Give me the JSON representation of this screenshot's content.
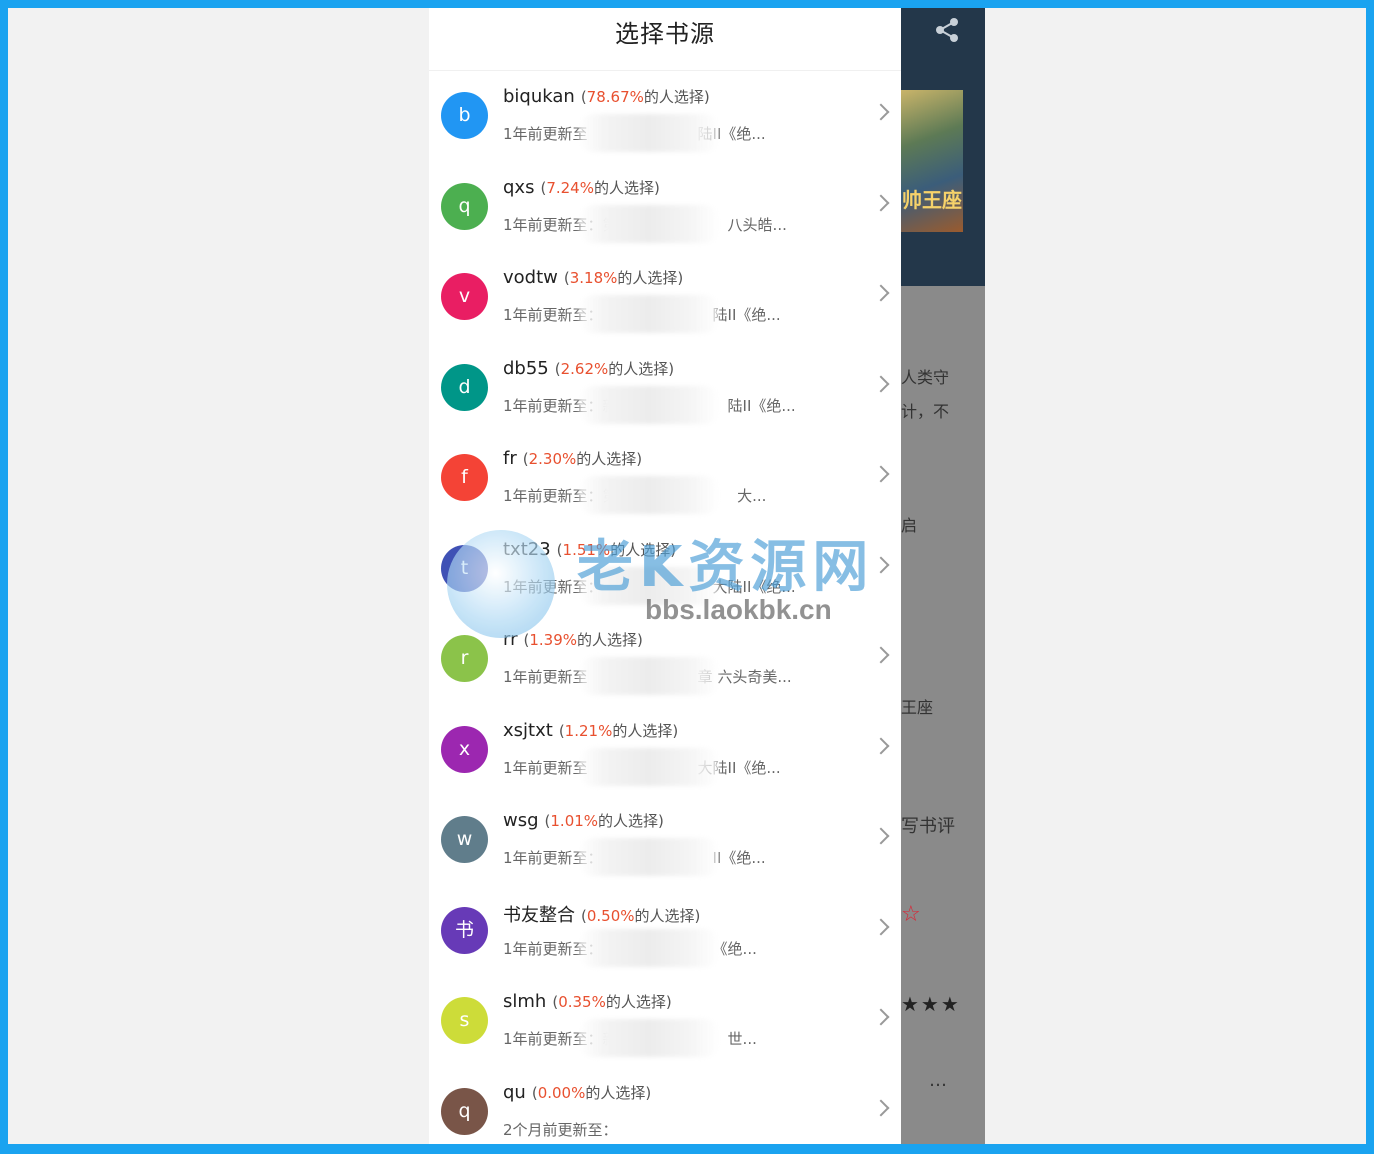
{
  "dialog": {
    "title": "选择书源",
    "sources": [
      {
        "initial": "b",
        "name": "biqukan",
        "percent": "78.67%",
        "suffix": "的人选择)",
        "update": "1年前更新至",
        "tail": "陆II《绝...",
        "color": "#2196f3"
      },
      {
        "initial": "q",
        "name": "qxs",
        "percent": "7.24%",
        "suffix": "的人选择)",
        "update": "1年前更新至：第",
        "tail": "八头皓...",
        "color": "#4caf50"
      },
      {
        "initial": "v",
        "name": "vodtw",
        "percent": "3.18%",
        "suffix": "的人选择)",
        "update": "1年前更新至：",
        "tail": "陆II《绝...",
        "color": "#e91e63"
      },
      {
        "initial": "d",
        "name": "db55",
        "percent": "2.62%",
        "suffix": "的人选择)",
        "update": "1年前更新至：新",
        "tail": "陆II《绝...",
        "color": "#009688"
      },
      {
        "initial": "f",
        "name": "fr",
        "percent": "2.30%",
        "suffix": "的人选择)",
        "update": "1年前更新至：第8",
        "tail": "大...",
        "color": "#f44336"
      },
      {
        "initial": "t",
        "name": "txt23",
        "percent": "1.51%",
        "suffix": "的人选择)",
        "update": "1年前更新至：",
        "tail": "大陆II《绝...",
        "color": "#3f51b5"
      },
      {
        "initial": "r",
        "name": "rr",
        "percent": "1.39%",
        "suffix": "的人选择)",
        "update": "1年前更新至",
        "tail": "章 六头奇美...",
        "color": "#8bc34a"
      },
      {
        "initial": "x",
        "name": "xsjtxt",
        "percent": "1.21%",
        "suffix": "的人选择)",
        "update": "1年前更新至",
        "tail": "大陆II《绝...",
        "color": "#9c27b0"
      },
      {
        "initial": "w",
        "name": "wsg",
        "percent": "1.01%",
        "suffix": "的人选择)",
        "update": "1年前更新至：",
        "tail": "II《绝...",
        "color": "#607d8b"
      },
      {
        "initial": "书",
        "name": "书友整合",
        "percent": "0.50%",
        "suffix": "的人选择)",
        "update": "1年前更新至：",
        "tail": "《绝...",
        "color": "#673ab7"
      },
      {
        "initial": "s",
        "name": "slmh",
        "percent": "0.35%",
        "suffix": "的人选择)",
        "update": "1年前更新至：新",
        "tail": "世...",
        "color": "#cddc39"
      },
      {
        "initial": "q",
        "name": "qu",
        "percent": "0.00%",
        "suffix": "的人选择)",
        "update": "2个月前更新至：",
        "tail": "",
        "color": "#795548"
      }
    ]
  },
  "background": {
    "cover_title": "帅王座",
    "snippet_line1": "人类守",
    "snippet_line2": "计，不",
    "row1": "启",
    "row2": "王座",
    "review": "写书评",
    "stars": "★★★",
    "star_outline": "☆",
    "more": "…"
  },
  "watermark": {
    "text": "老K资源网",
    "url": "bbs.laokbk.cn"
  },
  "colors": {
    "frame": "#1aa3f0",
    "percent": "#e8502f"
  }
}
